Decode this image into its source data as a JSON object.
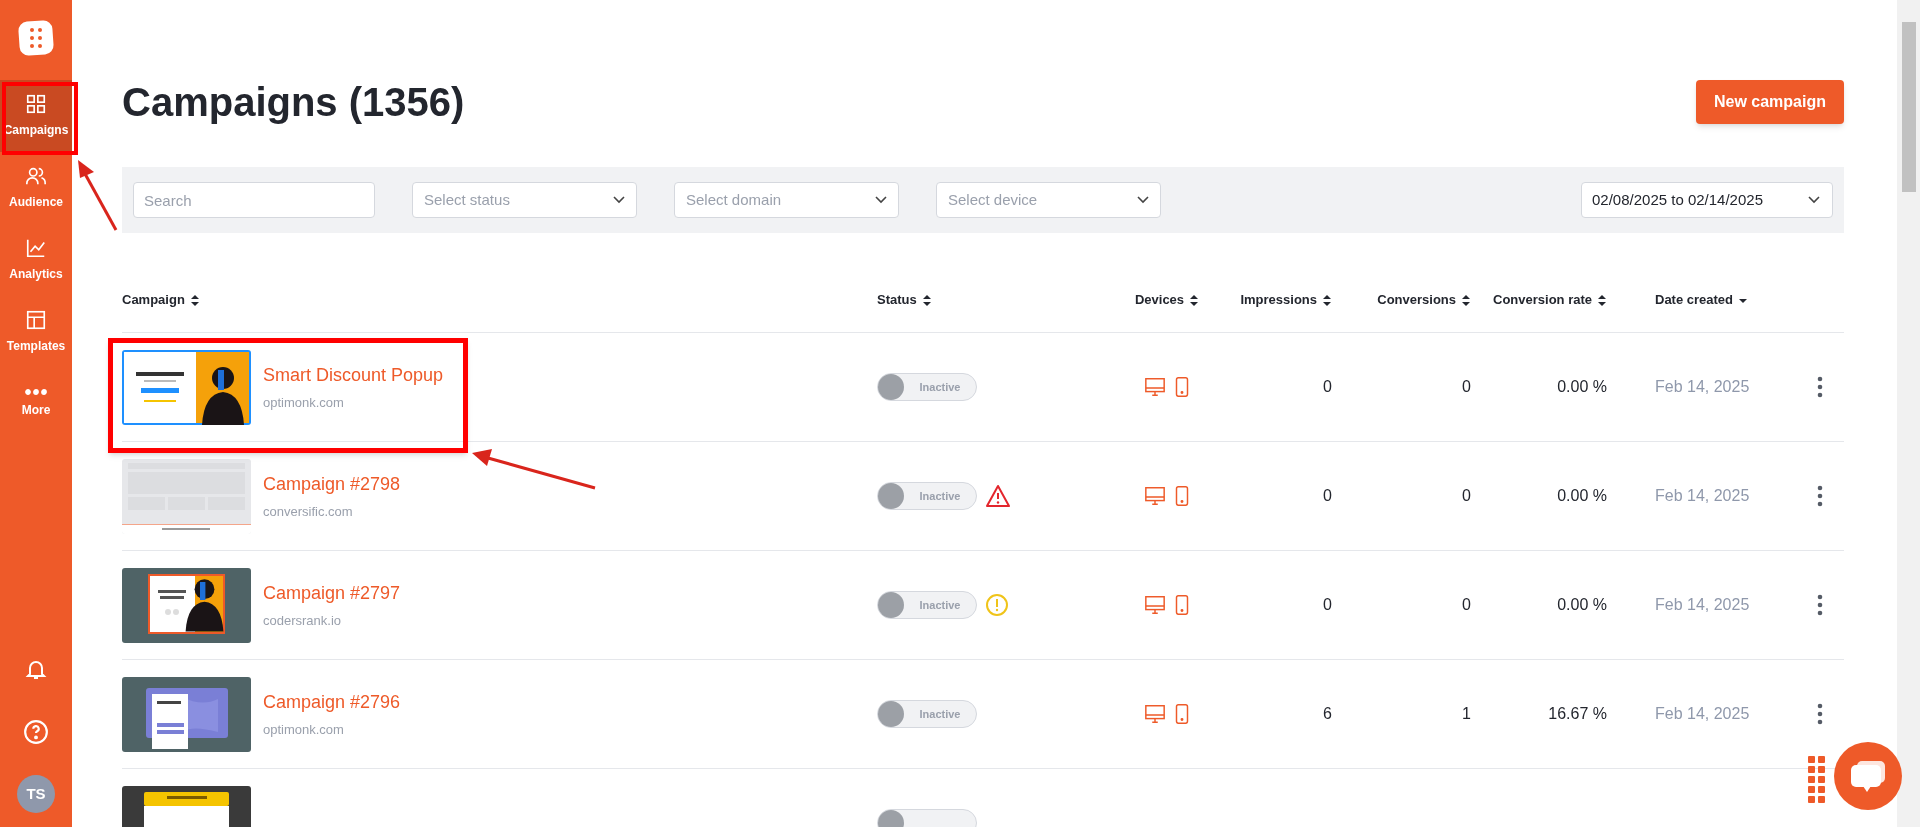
{
  "sidebar": {
    "items": [
      {
        "label": "Campaigns",
        "selected": true
      },
      {
        "label": "Audience",
        "selected": false
      },
      {
        "label": "Analytics",
        "selected": false
      },
      {
        "label": "Templates",
        "selected": false
      },
      {
        "label": "More",
        "selected": false
      }
    ],
    "avatar": "TS"
  },
  "title": "Campaigns (1356)",
  "new_button": "New campaign",
  "filters": {
    "search": {
      "placeholder": "Search"
    },
    "selects": [
      {
        "placeholder": "Select status"
      },
      {
        "placeholder": "Select domain"
      },
      {
        "placeholder": "Select device"
      }
    ],
    "date_range": "02/08/2025 to 02/14/2025"
  },
  "table": {
    "columns": [
      {
        "label": "Campaign",
        "kind": "sortable"
      },
      {
        "label": "Status",
        "kind": "sortable"
      },
      {
        "label": "Devices",
        "kind": "sortable"
      },
      {
        "label": "Impressions",
        "kind": "sortable"
      },
      {
        "label": "Conversions",
        "kind": "sortable"
      },
      {
        "label": "Conversion rate",
        "kind": "sortable"
      },
      {
        "label": "Date created",
        "kind": "sorted"
      }
    ],
    "rows": [
      {
        "name": "Smart Discount Popup",
        "domain": "optimonk.com",
        "on": false,
        "status": "Inactive",
        "impressions": "0",
        "conversions": "0",
        "rate": "0.00 %",
        "date": "Feb 14, 2025"
      },
      {
        "name": "Campaign #2798",
        "domain": "conversific.com",
        "on": false,
        "status": "Inactive",
        "alert": {
          "kind": "error"
        },
        "impressions": "0",
        "conversions": "0",
        "rate": "0.00 %",
        "date": "Feb 14, 2025"
      },
      {
        "name": "Campaign #2797",
        "domain": "codersrank.io",
        "on": false,
        "status": "Inactive",
        "alert": {
          "kind": "warning"
        },
        "impressions": "0",
        "conversions": "0",
        "rate": "0.00 %",
        "date": "Feb 14, 2025"
      },
      {
        "name": "Campaign #2796",
        "domain": "optimonk.com",
        "on": false,
        "status": "Inactive",
        "impressions": "6",
        "conversions": "1",
        "rate": "16.67 %",
        "date": "Feb 14, 2025"
      },
      {
        "on": false
      }
    ]
  }
}
